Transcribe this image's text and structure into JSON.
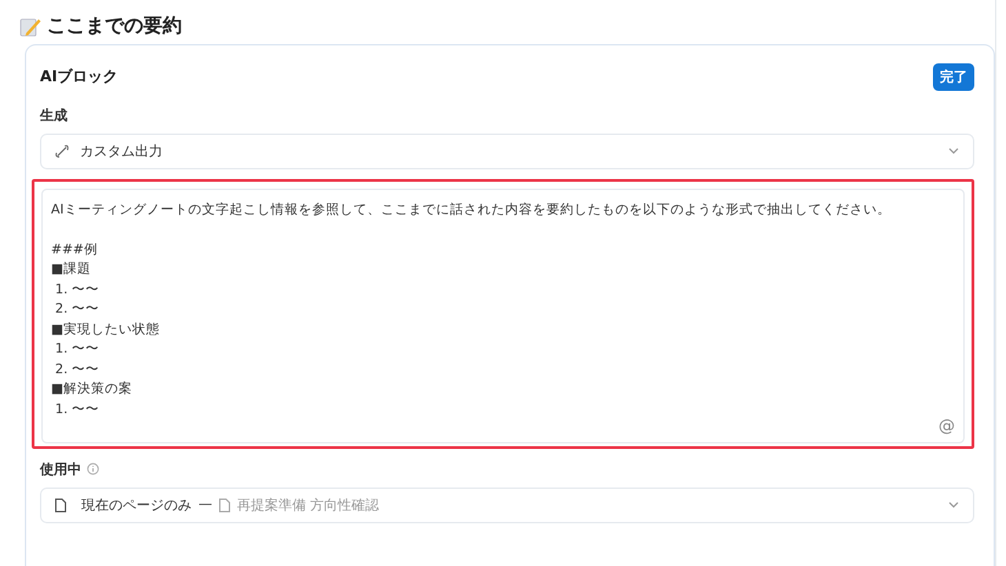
{
  "heading": {
    "title": "ここまでの要約"
  },
  "block": {
    "title": "AIブロック",
    "done_button": "完了",
    "generate": {
      "label": "生成",
      "value": "カスタム出力"
    },
    "prompt": {
      "highlighted": true,
      "instruction": "AIミーティングノートの文字起こし情報を参照して、ここまでに話された内容を要約したものを以下のような形式で抽出してください。",
      "example_lines": [
        "###例",
        "■課題",
        " 1. 〜〜",
        " 2. 〜〜",
        "■実現したい状態",
        " 1. 〜〜",
        " 2. 〜〜",
        "■解決策の案",
        " 1. 〜〜"
      ],
      "mention": "@"
    },
    "usage": {
      "label": "使用中",
      "value": "現在のページのみ",
      "separator": "—",
      "source": "再提案準備 方向性確認"
    }
  }
}
